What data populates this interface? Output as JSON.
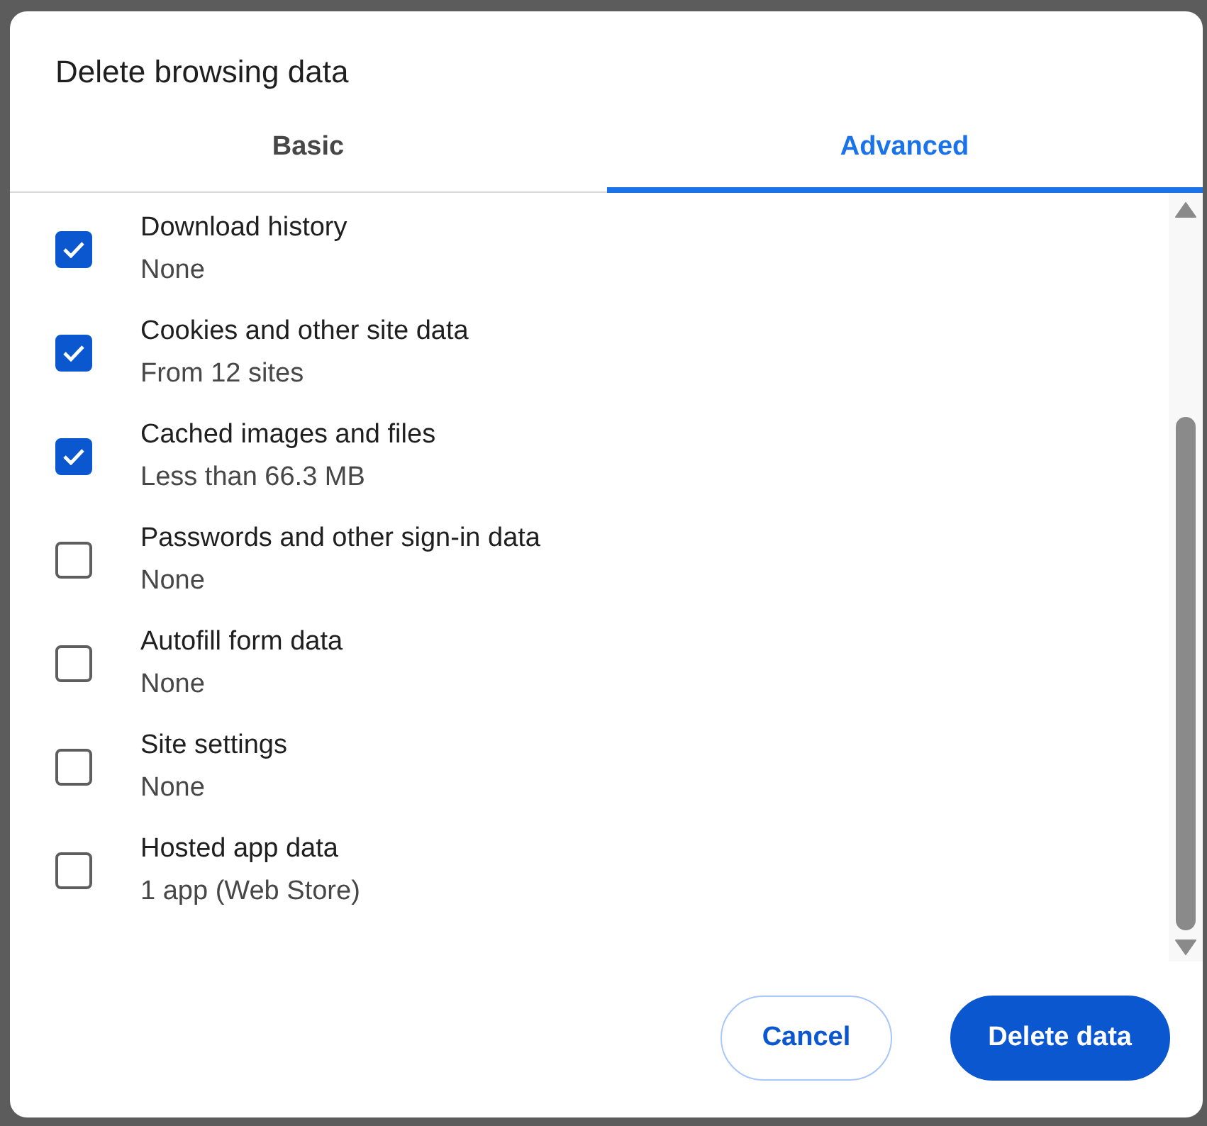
{
  "dialog": {
    "title": "Delete browsing data"
  },
  "tabs": [
    {
      "label": "Basic",
      "selected": false
    },
    {
      "label": "Advanced",
      "selected": true
    }
  ],
  "items": [
    {
      "label": "Download history",
      "detail": "None",
      "checked": true
    },
    {
      "label": "Cookies and other site data",
      "detail": "From 12 sites",
      "checked": true
    },
    {
      "label": "Cached images and files",
      "detail": "Less than 66.3 MB",
      "checked": true
    },
    {
      "label": "Passwords and other sign-in data",
      "detail": "None",
      "checked": false
    },
    {
      "label": "Autofill form data",
      "detail": "None",
      "checked": false
    },
    {
      "label": "Site settings",
      "detail": "None",
      "checked": false
    },
    {
      "label": "Hosted app data",
      "detail": "1 app (Web Store)",
      "checked": false
    }
  ],
  "buttons": [
    {
      "label": "Cancel",
      "kind": "secondary"
    },
    {
      "label": "Delete data",
      "kind": "primary"
    }
  ]
}
